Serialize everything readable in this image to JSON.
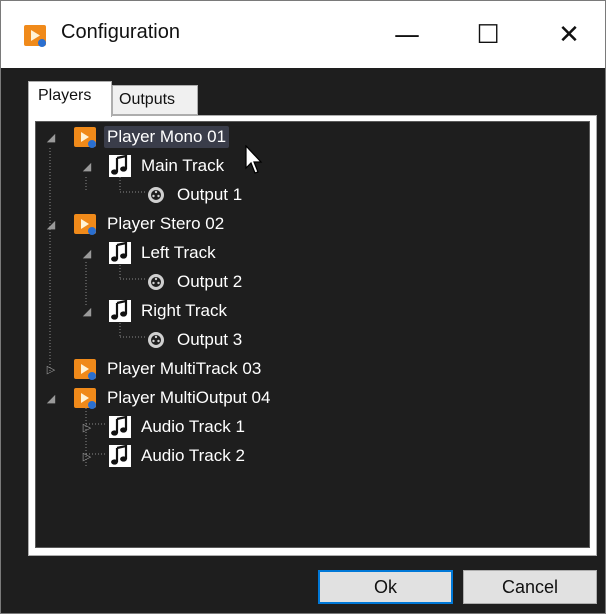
{
  "window": {
    "title": "Configuration",
    "minimize_glyph": "—",
    "maximize_glyph": "☐",
    "close_glyph": "✕"
  },
  "tabs": [
    {
      "label": "Players",
      "selected": true
    },
    {
      "label": "Outputs",
      "selected": false
    }
  ],
  "tree": [
    {
      "label": "Player Mono 01",
      "type": "player",
      "selected": true,
      "expanded": true
    },
    {
      "label": "Main Track",
      "type": "track",
      "expanded": true
    },
    {
      "label": "Output 1",
      "type": "output"
    },
    {
      "label": "Player Stero 02",
      "type": "player",
      "expanded": true
    },
    {
      "label": "Left Track",
      "type": "track",
      "expanded": true
    },
    {
      "label": "Output 2",
      "type": "output"
    },
    {
      "label": "Right Track",
      "type": "track",
      "expanded": true
    },
    {
      "label": "Output 3",
      "type": "output"
    },
    {
      "label": "Player MultiTrack 03",
      "type": "player",
      "expanded": false
    },
    {
      "label": "Player MultiOutput 04",
      "type": "player",
      "expanded": true
    },
    {
      "label": "Audio Track 1",
      "type": "track",
      "expanded": false
    },
    {
      "label": "Audio Track 2",
      "type": "track",
      "expanded": false
    }
  ],
  "buttons": {
    "ok": "Ok",
    "cancel": "Cancel"
  },
  "colors": {
    "player_icon": "#f08a1a",
    "selection": "#3a3d4a",
    "tree_bg": "#1e1e1e",
    "default_button_border": "#0078d7"
  }
}
